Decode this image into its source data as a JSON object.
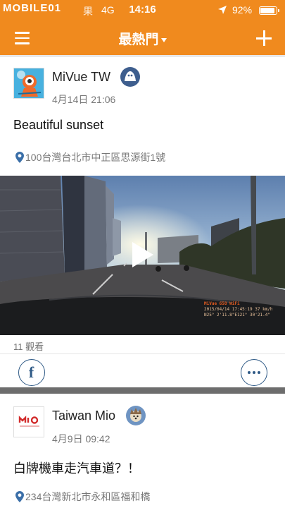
{
  "status_bar": {
    "watermark": "MOBILE01",
    "carrier": "果",
    "network": "4G",
    "time": "14:16",
    "battery_percent": "92%",
    "battery_level": 0.92
  },
  "nav": {
    "title": "最熱門"
  },
  "posts": [
    {
      "username": "MiVue TW",
      "timestamp": "4月14日 21:06",
      "text": "Beautiful sunset",
      "location": "100台灣台北市中正區思源街1號",
      "video_overlay": {
        "brand": "MiVue 658 WiFi",
        "line1": "2015/04/14  17:45:19    37 km/h",
        "line2": "N25° 2'11.8\"E121° 30'21.4\""
      },
      "views": "11 觀看"
    },
    {
      "username": "Taiwan Mio",
      "timestamp": "4月9日 09:42",
      "text": "白牌機車走汽車道？！",
      "location": "234台灣新北市永和區福和橋"
    }
  ],
  "colors": {
    "accent": "#f08a1e",
    "icon_blue": "#2f5a86"
  }
}
